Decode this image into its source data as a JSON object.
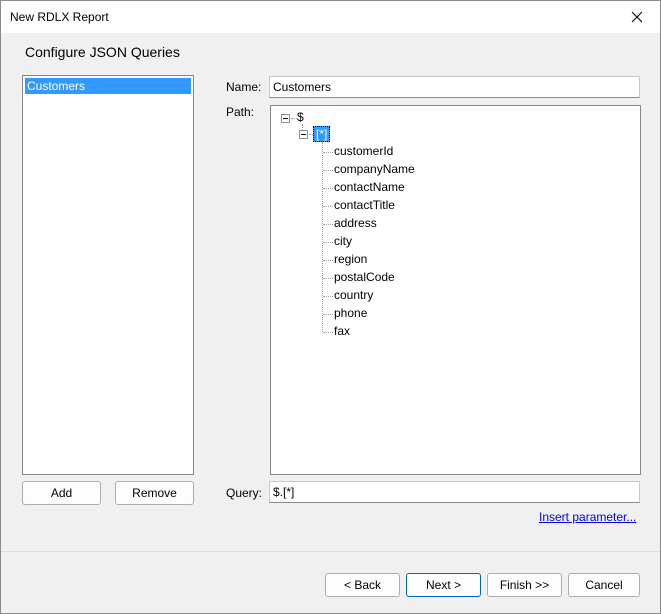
{
  "window": {
    "title": "New RDLX Report",
    "close_icon": "close-icon"
  },
  "page": {
    "heading": "Configure JSON Queries"
  },
  "queries": {
    "items": [
      {
        "label": "Customers",
        "selected": true
      }
    ],
    "add_label": "Add",
    "remove_label": "Remove"
  },
  "form": {
    "name_label": "Name:",
    "name_value": "Customers",
    "path_label": "Path:",
    "query_label": "Query:",
    "query_value": "$.[*]",
    "insert_parameter": "Insert parameter..."
  },
  "tree": {
    "root": "$",
    "array_node": "[*]",
    "fields": [
      "customerId",
      "companyName",
      "contactName",
      "contactTitle",
      "address",
      "city",
      "region",
      "postalCode",
      "country",
      "phone",
      "fax"
    ]
  },
  "footer": {
    "back_label": "< Back",
    "next_label": "Next >",
    "finish_label": "Finish >>",
    "cancel_label": "Cancel"
  }
}
